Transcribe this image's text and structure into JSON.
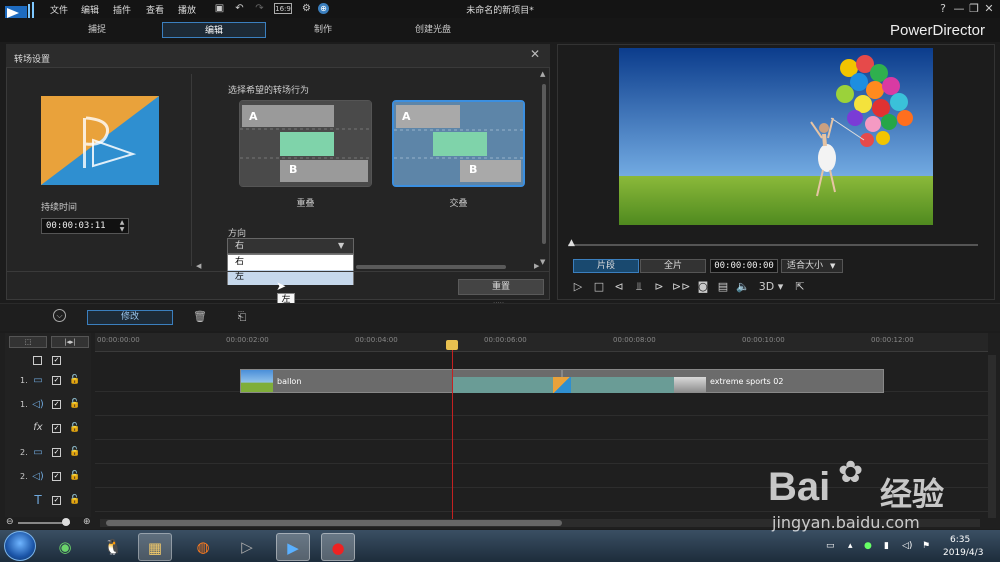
{
  "menu": [
    "文件",
    "编辑",
    "插件",
    "查看",
    "播放"
  ],
  "project_title": "未命名的新项目*",
  "app_name": "PowerDirector",
  "win_buttons": [
    "?",
    "—",
    "❐",
    "✕"
  ],
  "mode_tabs": [
    "捕捉",
    "编辑",
    "制作",
    "创建光盘"
  ],
  "panel": {
    "title": "转场设置",
    "duration_label": "持续时间",
    "duration_value": "00:00:03:11",
    "behavior_label": "选择希望的转场行为",
    "behaviors": [
      "重叠",
      "交叠"
    ],
    "letters": [
      "A",
      "B"
    ],
    "direction_label": "方向",
    "direction_value": "右",
    "direction_options": [
      "右",
      "左"
    ],
    "tooltip": "左",
    "reset_label": "重置"
  },
  "preview": {
    "clip_label": "片段",
    "full_label": "全片",
    "time": "00:00:00:00",
    "fit": "适合大小",
    "threed": "3D"
  },
  "toolbar": {
    "modify_label": "修改"
  },
  "ruler": [
    "00:00:00:00",
    "00:00:02:00",
    "00:00:04:00",
    "00:00:06:00",
    "00:00:08:00",
    "00:00:10:00",
    "00:00:12:00"
  ],
  "tracks": [
    {
      "num": "1.",
      "kind": "video"
    },
    {
      "num": "1.",
      "kind": "audio"
    },
    {
      "num": "",
      "kind": "fx"
    },
    {
      "num": "2.",
      "kind": "video"
    },
    {
      "num": "2.",
      "kind": "audio"
    },
    {
      "num": "",
      "kind": "title"
    }
  ],
  "clips": [
    "ballon",
    "extreme sports 02"
  ],
  "clock": {
    "time": "6:35",
    "date": "2019/4/3"
  },
  "watermark": {
    "brand": "Bai",
    "brand2": "经验",
    "url": "jingyan.baidu.com"
  }
}
